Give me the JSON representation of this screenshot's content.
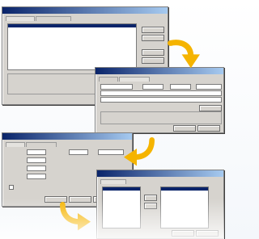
{
  "windows": [
    {
      "title": "",
      "tabs": [
        "",
        ""
      ],
      "buttons": [
        "",
        "",
        "",
        ""
      ],
      "status": "",
      "footer_buttons": [
        "",
        ""
      ]
    },
    {
      "title": "",
      "tabs": [
        "",
        ""
      ],
      "buttons": [
        "",
        ""
      ],
      "footer_buttons": [
        "",
        ""
      ]
    },
    {
      "title": "",
      "tabs": [
        "",
        ""
      ],
      "rows": [
        "",
        "",
        "",
        ""
      ],
      "footer_buttons": [
        "",
        "",
        ""
      ]
    },
    {
      "title": "",
      "tabs": [
        ""
      ],
      "left_list": [
        "",
        "",
        "",
        "",
        ""
      ],
      "right_list": [
        "",
        "",
        "",
        "",
        ""
      ],
      "footer_buttons": [
        "",
        ""
      ]
    }
  ],
  "colors": {
    "arrow": "#f5b400",
    "titlebar": "#0a246a"
  },
  "icons": [
    "curved-arrow-icon",
    "curved-arrow-icon",
    "curved-arrow-icon"
  ]
}
